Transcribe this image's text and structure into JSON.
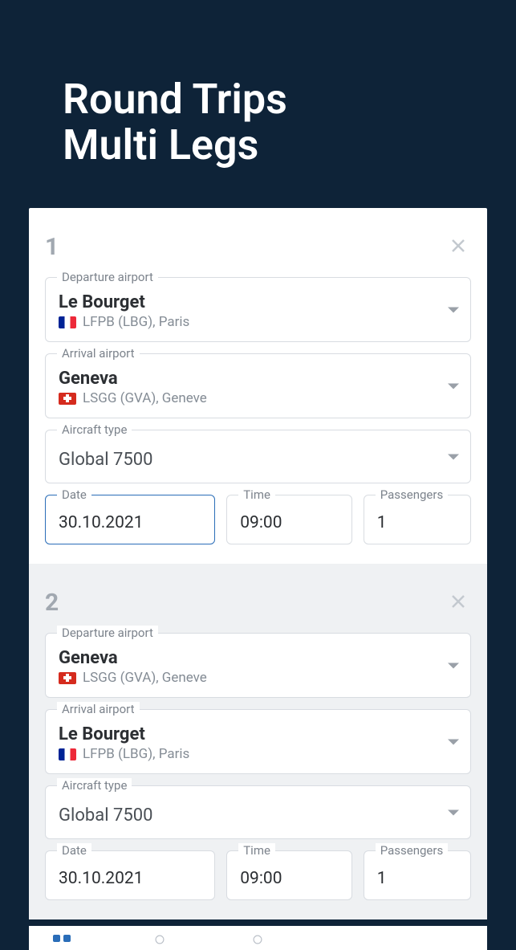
{
  "title_line1": "Round Trips",
  "title_line2": "Multi Legs",
  "labels": {
    "departure": "Departure airport",
    "arrival": "Arrival airport",
    "aircraft": "Aircraft type",
    "date": "Date",
    "time": "Time",
    "passengers": "Passengers"
  },
  "legs": [
    {
      "number": "1",
      "departure": {
        "name": "Le Bourget",
        "code": "LFPB (LBG), Paris",
        "flag": "fr"
      },
      "arrival": {
        "name": "Geneva",
        "code": "LSGG (GVA), Geneve",
        "flag": "ch"
      },
      "aircraft": "Global 7500",
      "date": "30.10.2021",
      "time": "09:00",
      "passengers": "1",
      "date_focused": true
    },
    {
      "number": "2",
      "departure": {
        "name": "Geneva",
        "code": "LSGG (GVA), Geneve",
        "flag": "ch"
      },
      "arrival": {
        "name": "Le Bourget",
        "code": "LFPB (LBG), Paris",
        "flag": "fr"
      },
      "aircraft": "Global 7500",
      "date": "30.10.2021",
      "time": "09:00",
      "passengers": "1",
      "date_focused": false
    }
  ]
}
